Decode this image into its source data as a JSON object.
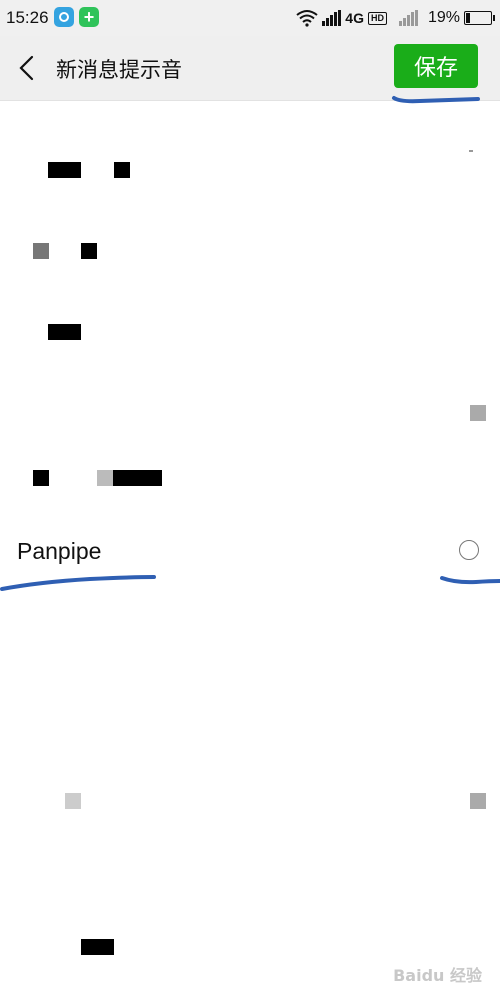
{
  "status_bar": {
    "time": "15:26",
    "network": "4G",
    "hd_badge": "HD",
    "battery_text": "19%",
    "battery_level": 0.19,
    "icons": [
      "app-blue-icon",
      "app-green-plus-icon",
      "wifi-icon",
      "signal-icon",
      "hd-icon",
      "signal-weak-icon",
      "battery-icon"
    ]
  },
  "header": {
    "title": "新消息提示音",
    "back_icon": "chevron-left-icon",
    "save_label": "保存"
  },
  "sound_options": [
    {
      "label": "",
      "selected": false
    },
    {
      "label": "",
      "selected": false
    },
    {
      "label": "",
      "selected": false
    },
    {
      "label": "",
      "selected": false
    },
    {
      "label": "",
      "selected": false
    },
    {
      "label": "Panpipe",
      "selected": false
    },
    {
      "label": "",
      "selected": false
    },
    {
      "label": "",
      "selected": false
    },
    {
      "label": "",
      "selected": false
    },
    {
      "label": "",
      "selected": false
    },
    {
      "label": "",
      "selected": false
    }
  ],
  "watermark": "Baidu 经验",
  "colors": {
    "accent": "#1aad19",
    "annotation": "#2f5fb3",
    "header_bg": "#efefef"
  }
}
